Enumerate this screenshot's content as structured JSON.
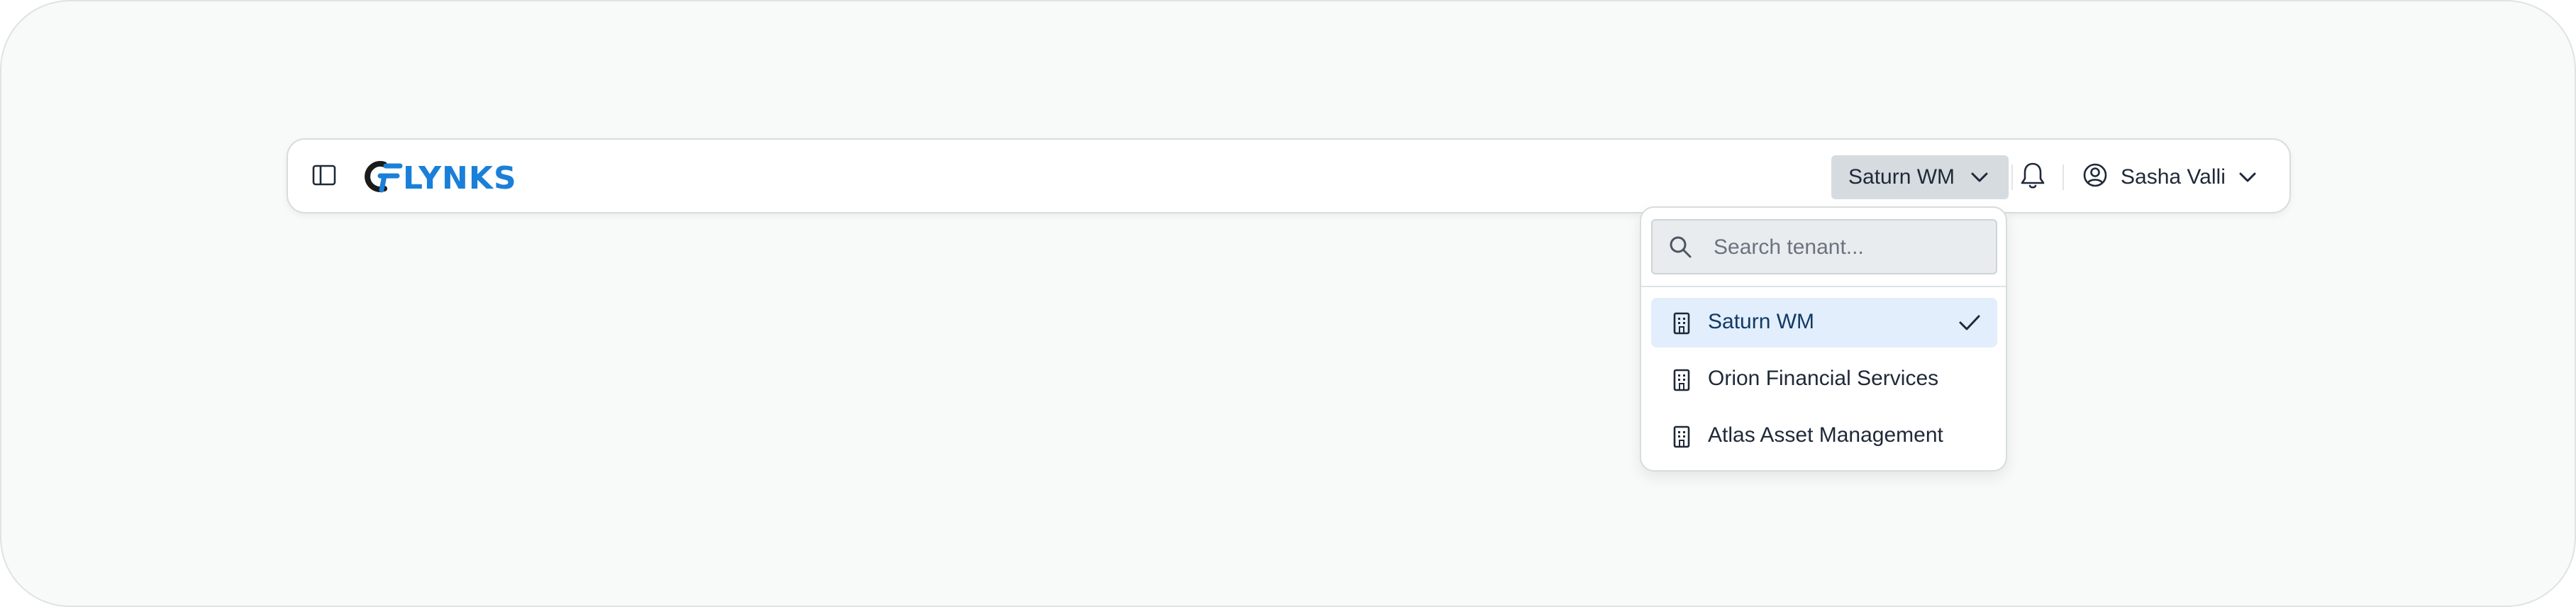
{
  "header": {
    "sidebar_toggle_icon": "sidebar-panel-icon",
    "logo_text": "LYNKS",
    "brand_color": "#1a7fd9",
    "tenant_selector": {
      "label": "Saturn WM",
      "icon": "chevron-down-icon"
    },
    "notifications_icon": "bell-icon",
    "user": {
      "name": "Sasha Valli",
      "icon": "user-circle-icon",
      "chevron": "chevron-down-icon"
    }
  },
  "tenant_dropdown": {
    "search_placeholder": "Search tenant...",
    "search_icon": "search-icon",
    "items": [
      {
        "label": "Saturn WM",
        "icon": "building-icon",
        "selected": true
      },
      {
        "label": "Orion Financial Services",
        "icon": "building-icon",
        "selected": false
      },
      {
        "label": "Atlas Asset Management",
        "icon": "building-icon",
        "selected": false
      }
    ]
  }
}
